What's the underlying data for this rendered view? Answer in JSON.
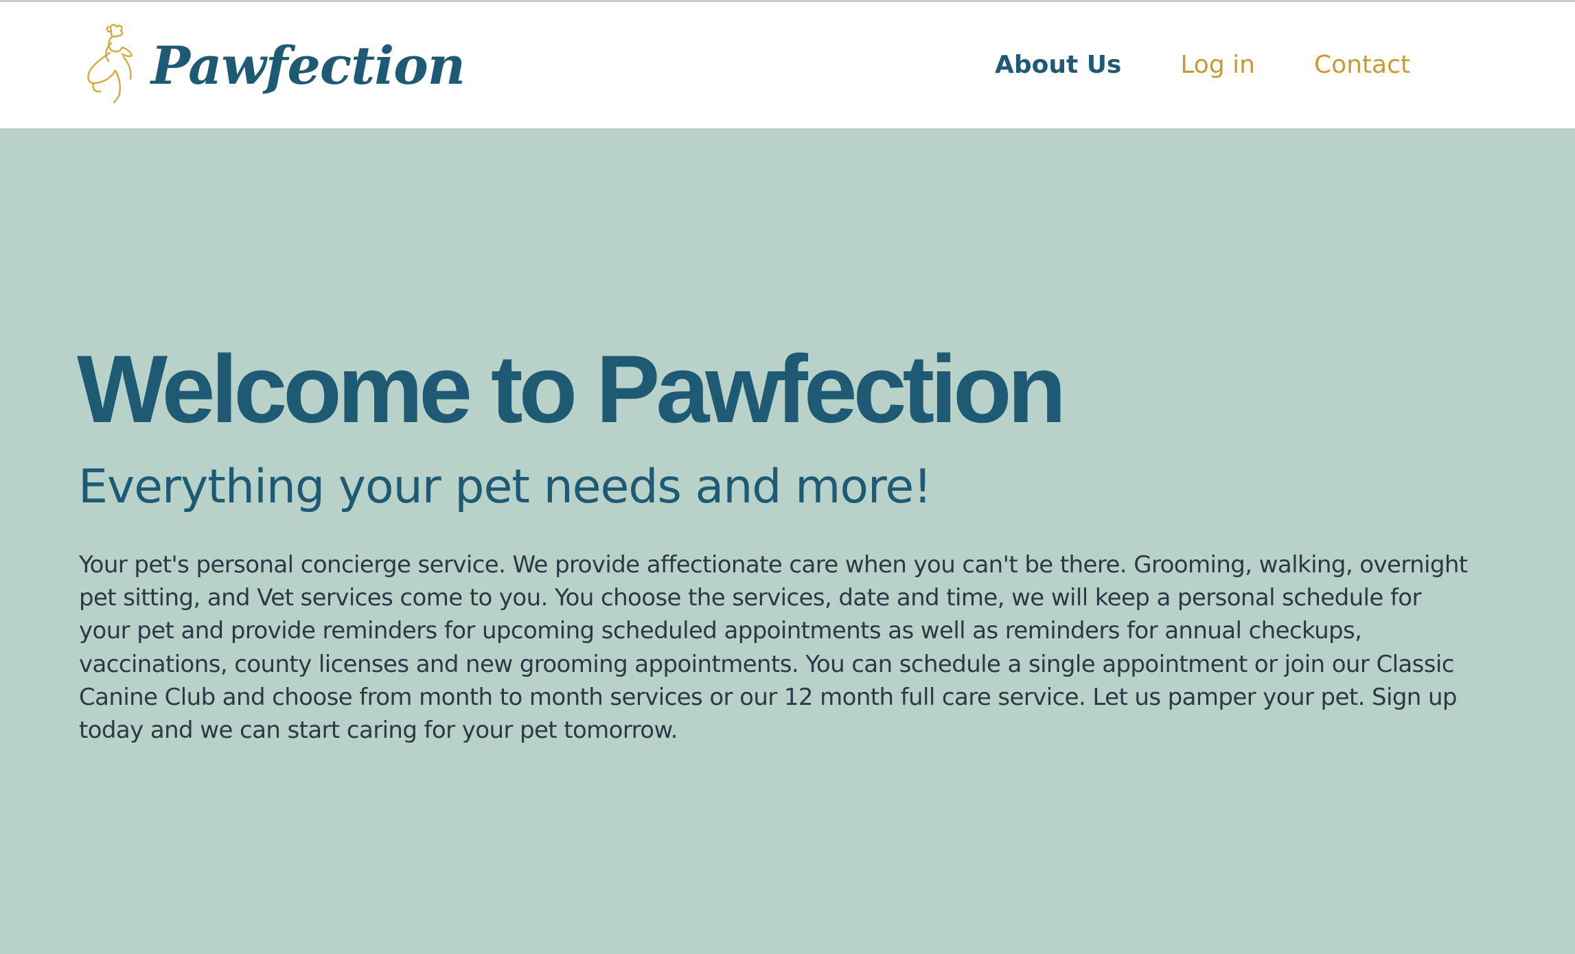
{
  "colors": {
    "brand_dark": "#1e5a73",
    "brand_gold": "#c99a2e",
    "hero_background": "#b8d1c9",
    "body_text": "#2a3a44"
  },
  "header": {
    "logo": {
      "icon": "poodle-icon",
      "text": "Pawfection"
    },
    "nav": [
      {
        "label": "About Us",
        "active": true
      },
      {
        "label": "Log in",
        "active": false
      },
      {
        "label": "Contact",
        "active": false
      }
    ]
  },
  "hero": {
    "title": "Welcome to Pawfection",
    "subtitle": "Everything your pet needs and more!",
    "body": "Your pet's personal concierge service. We provide affectionate care when you can't be there. Grooming, walking, overnight pet sitting, and Vet services come to you. You choose the services, date and time, we will keep a personal schedule for your pet and provide reminders for upcoming scheduled appointments as well as reminders for annual checkups, vaccinations, county licenses and new grooming appointments. You can schedule a single appointment or join our Classic Canine Club and choose from month to month services or our 12 month full care service. Let us pamper your pet. Sign up today and we can start caring for your pet tomorrow."
  }
}
